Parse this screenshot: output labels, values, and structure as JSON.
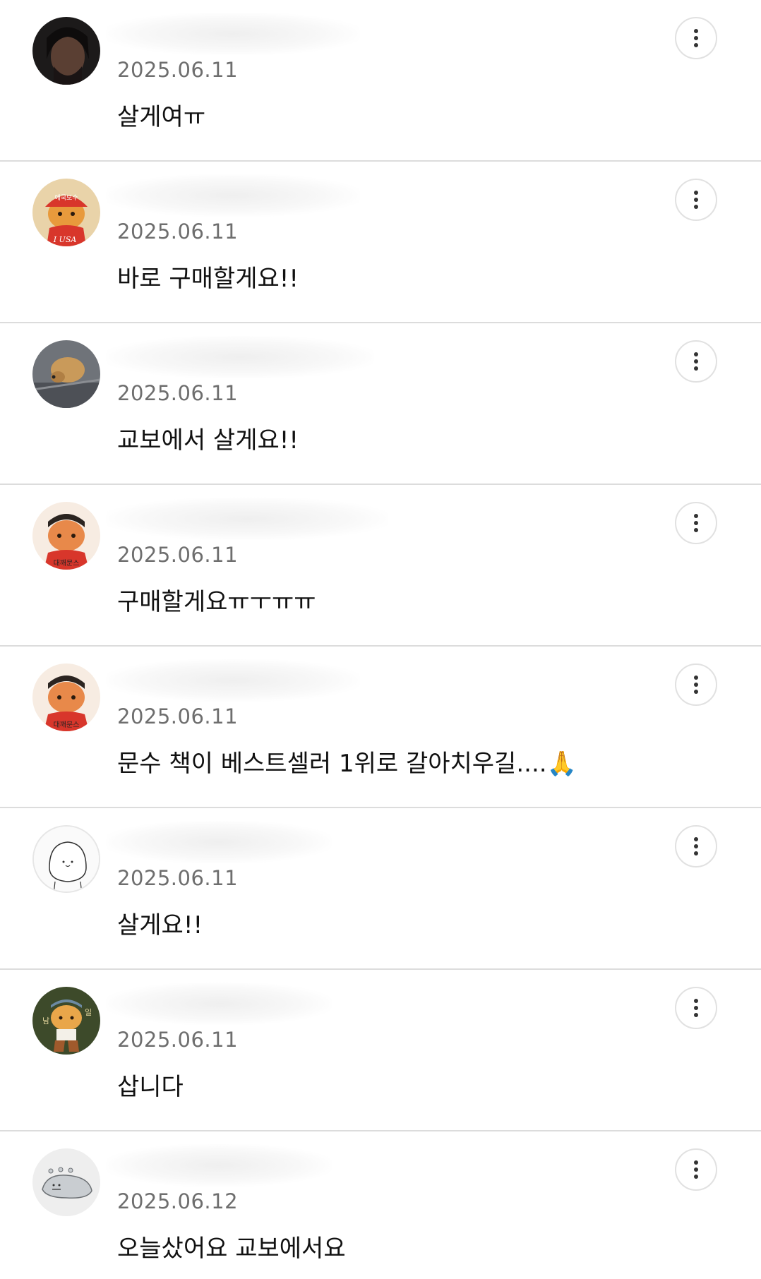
{
  "comments": [
    {
      "date": "2025.06.11",
      "text": "살게여ㅠ"
    },
    {
      "date": "2025.06.11",
      "text": "바로 구매할게요!!"
    },
    {
      "date": "2025.06.11",
      "text": "교보에서 살게요!!"
    },
    {
      "date": "2025.06.11",
      "text": "구매할게요ㅠㅜㅠㅠ"
    },
    {
      "date": "2025.06.11",
      "text": "문수 책이 베스트셀러 1위로 갈아치우길....🙏"
    },
    {
      "date": "2025.06.11",
      "text": "살게요!!"
    },
    {
      "date": "2025.06.11",
      "text": "삽니다"
    },
    {
      "date": "2025.06.12",
      "text": "오늘샀어요 교보에서요"
    }
  ],
  "avatar_texts": {
    "usa_cap": "애국보수",
    "usa_shirt": "I USA",
    "munsu": "대깨문스",
    "namil_left": "남",
    "namil_right": "일"
  },
  "colors": {
    "date": "#6e6e6e",
    "divider": "#dcdcdc",
    "more_border": "#e1e1e1"
  },
  "icons": {
    "more": "more-vertical-icon"
  }
}
